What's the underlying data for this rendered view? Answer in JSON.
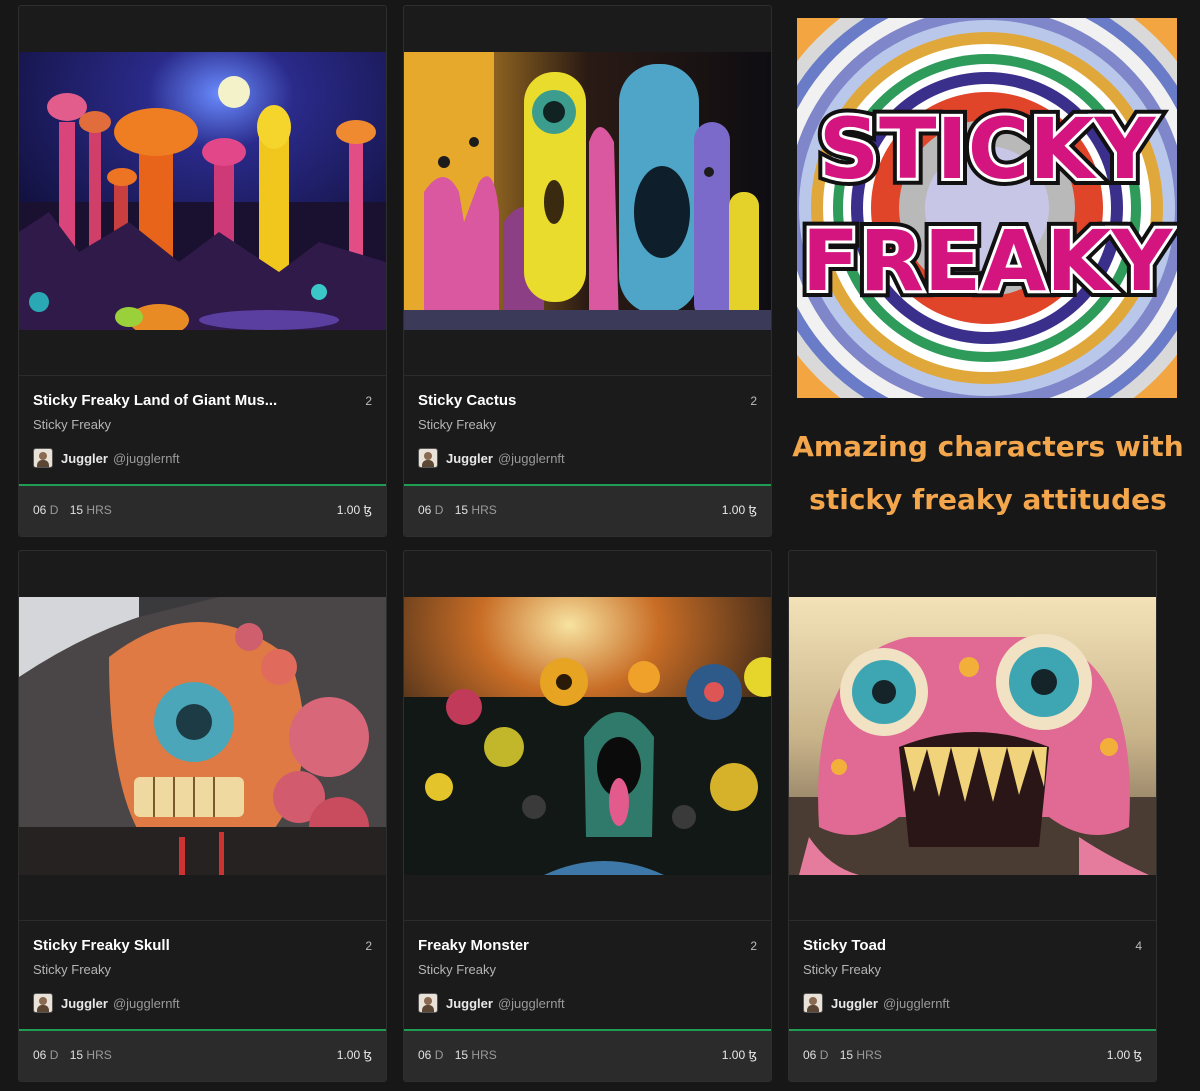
{
  "cards": [
    {
      "title": "Sticky Freaky Land of Giant Mus...",
      "count": "2",
      "collection": "Sticky Freaky",
      "creator": "Juggler",
      "handle": "@jugglernft",
      "days": "06",
      "days_unit": "D",
      "hours": "15",
      "hours_unit": "HRS",
      "price": "1.00 ꜩ"
    },
    {
      "title": "Sticky Cactus",
      "count": "2",
      "collection": "Sticky Freaky",
      "creator": "Juggler",
      "handle": "@jugglernft",
      "days": "06",
      "days_unit": "D",
      "hours": "15",
      "hours_unit": "HRS",
      "price": "1.00 ꜩ"
    },
    {
      "title": "Sticky Freaky Skull",
      "count": "2",
      "collection": "Sticky Freaky",
      "creator": "Juggler",
      "handle": "@jugglernft",
      "days": "06",
      "days_unit": "D",
      "hours": "15",
      "hours_unit": "HRS",
      "price": "1.00 ꜩ"
    },
    {
      "title": "Freaky Monster",
      "count": "2",
      "collection": "Sticky Freaky",
      "creator": "Juggler",
      "handle": "@jugglernft",
      "days": "06",
      "days_unit": "D",
      "hours": "15",
      "hours_unit": "HRS",
      "price": "1.00 ꜩ"
    },
    {
      "title": "Sticky Toad",
      "count": "4",
      "collection": "Sticky Freaky",
      "creator": "Juggler",
      "handle": "@jugglernft",
      "days": "06",
      "days_unit": "D",
      "hours": "15",
      "hours_unit": "HRS",
      "price": "1.00 ꜩ"
    }
  ],
  "promo": {
    "logo_line1": "STICKY",
    "logo_line2": "FREAKY",
    "tagline_line1": "Amazing characters with",
    "tagline_line2": "sticky freaky attitudes"
  },
  "colors": {
    "accent_green": "#1f9d55",
    "tagline_orange": "#f3a64b",
    "logo_magenta": "#d4157f"
  }
}
